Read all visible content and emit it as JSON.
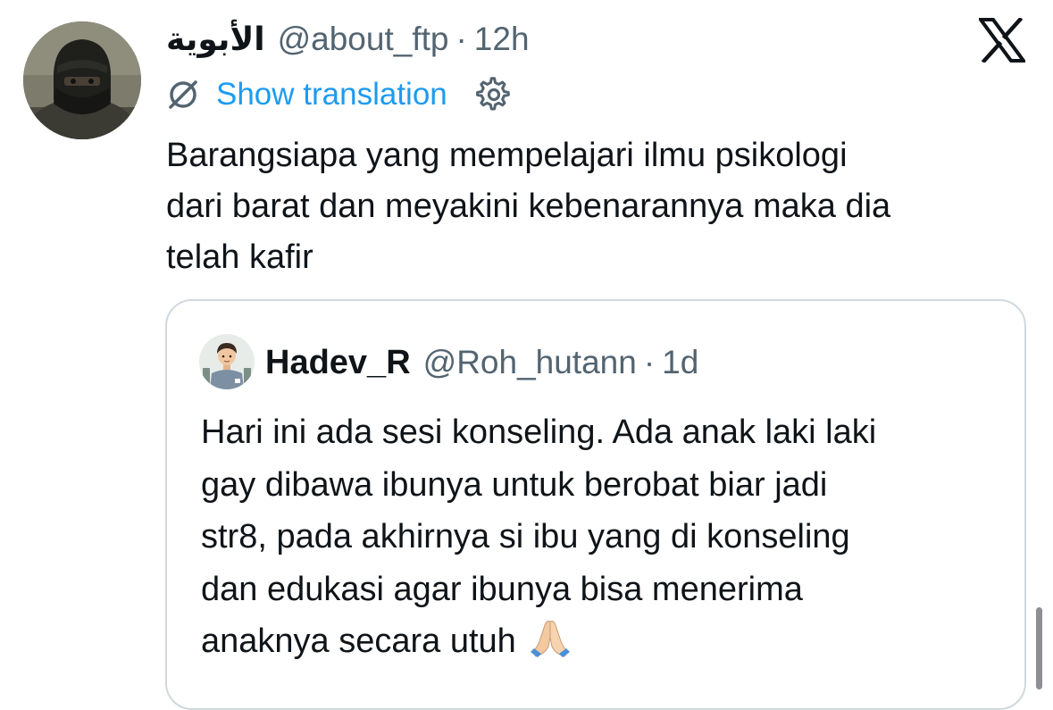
{
  "tweet": {
    "display_name": "الأبوية",
    "handle": "@about_ftp",
    "separator": "·",
    "time": "12h",
    "show_translation_label": "Show translation",
    "text": "Barangsiapa yang mempelajari ilmu psikologi\ndari barat dan meyakini kebenarannya maka dia\ntelah kafir",
    "avatar_icon": "avatar-masked-person",
    "close_icon": "x-logo-icon"
  },
  "quoted_tweet": {
    "display_name": "Hadev_R",
    "handle": "@Roh_hutann",
    "separator": "·",
    "time": "1d",
    "text": "Hari ini ada sesi konseling. Ada anak laki laki\ngay dibawa ibunya untuk berobat biar jadi\nstr8, pada akhirnya si ibu yang di konseling\ndan edukasi agar ibunya bisa menerima\nanaknya secara utuh",
    "trailing_emoji": "folded-hands-icon",
    "avatar_icon": "avatar-cartoon-man"
  },
  "colors": {
    "text_primary": "#0f1419",
    "text_secondary": "#536471",
    "link": "#1d9bf0",
    "border": "#cfd9de"
  }
}
